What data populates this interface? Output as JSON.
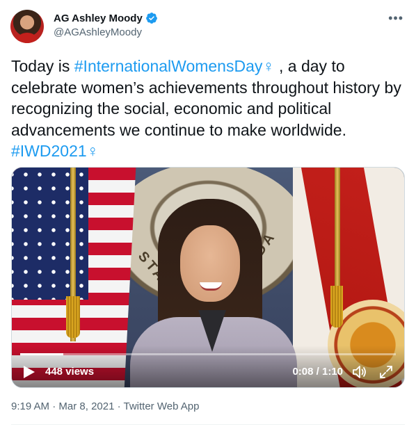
{
  "author": {
    "display_name": "AG Ashley Moody",
    "handle": "@AGAshleyMoody",
    "verified": true,
    "verified_color": "#1d9bf0"
  },
  "more_icon": "more-horizontal-icon",
  "tweet": {
    "text_part1": "Today is ",
    "hashtag1": "#InternationalWomensDay",
    "symbol1": "♀",
    "text_part2": " , a day to celebrate women’s achievements throughout history by recognizing the social, economic and political advancements we continue to make worldwide.",
    "hashtag2": "#IWD2021",
    "symbol2": "♀",
    "link_color": "#1d9bf0"
  },
  "video": {
    "seal_text_left": "STA",
    "seal_text_right": "IDA",
    "views": "448 views",
    "time": "0:08 / 1:10",
    "progress": 0.114,
    "icons": [
      "play-icon",
      "volume-icon",
      "fullscreen-icon"
    ]
  },
  "meta": {
    "time": "9:19 AM",
    "separator": " · ",
    "date": "Mar 8, 2021",
    "source": "Twitter Web App"
  }
}
